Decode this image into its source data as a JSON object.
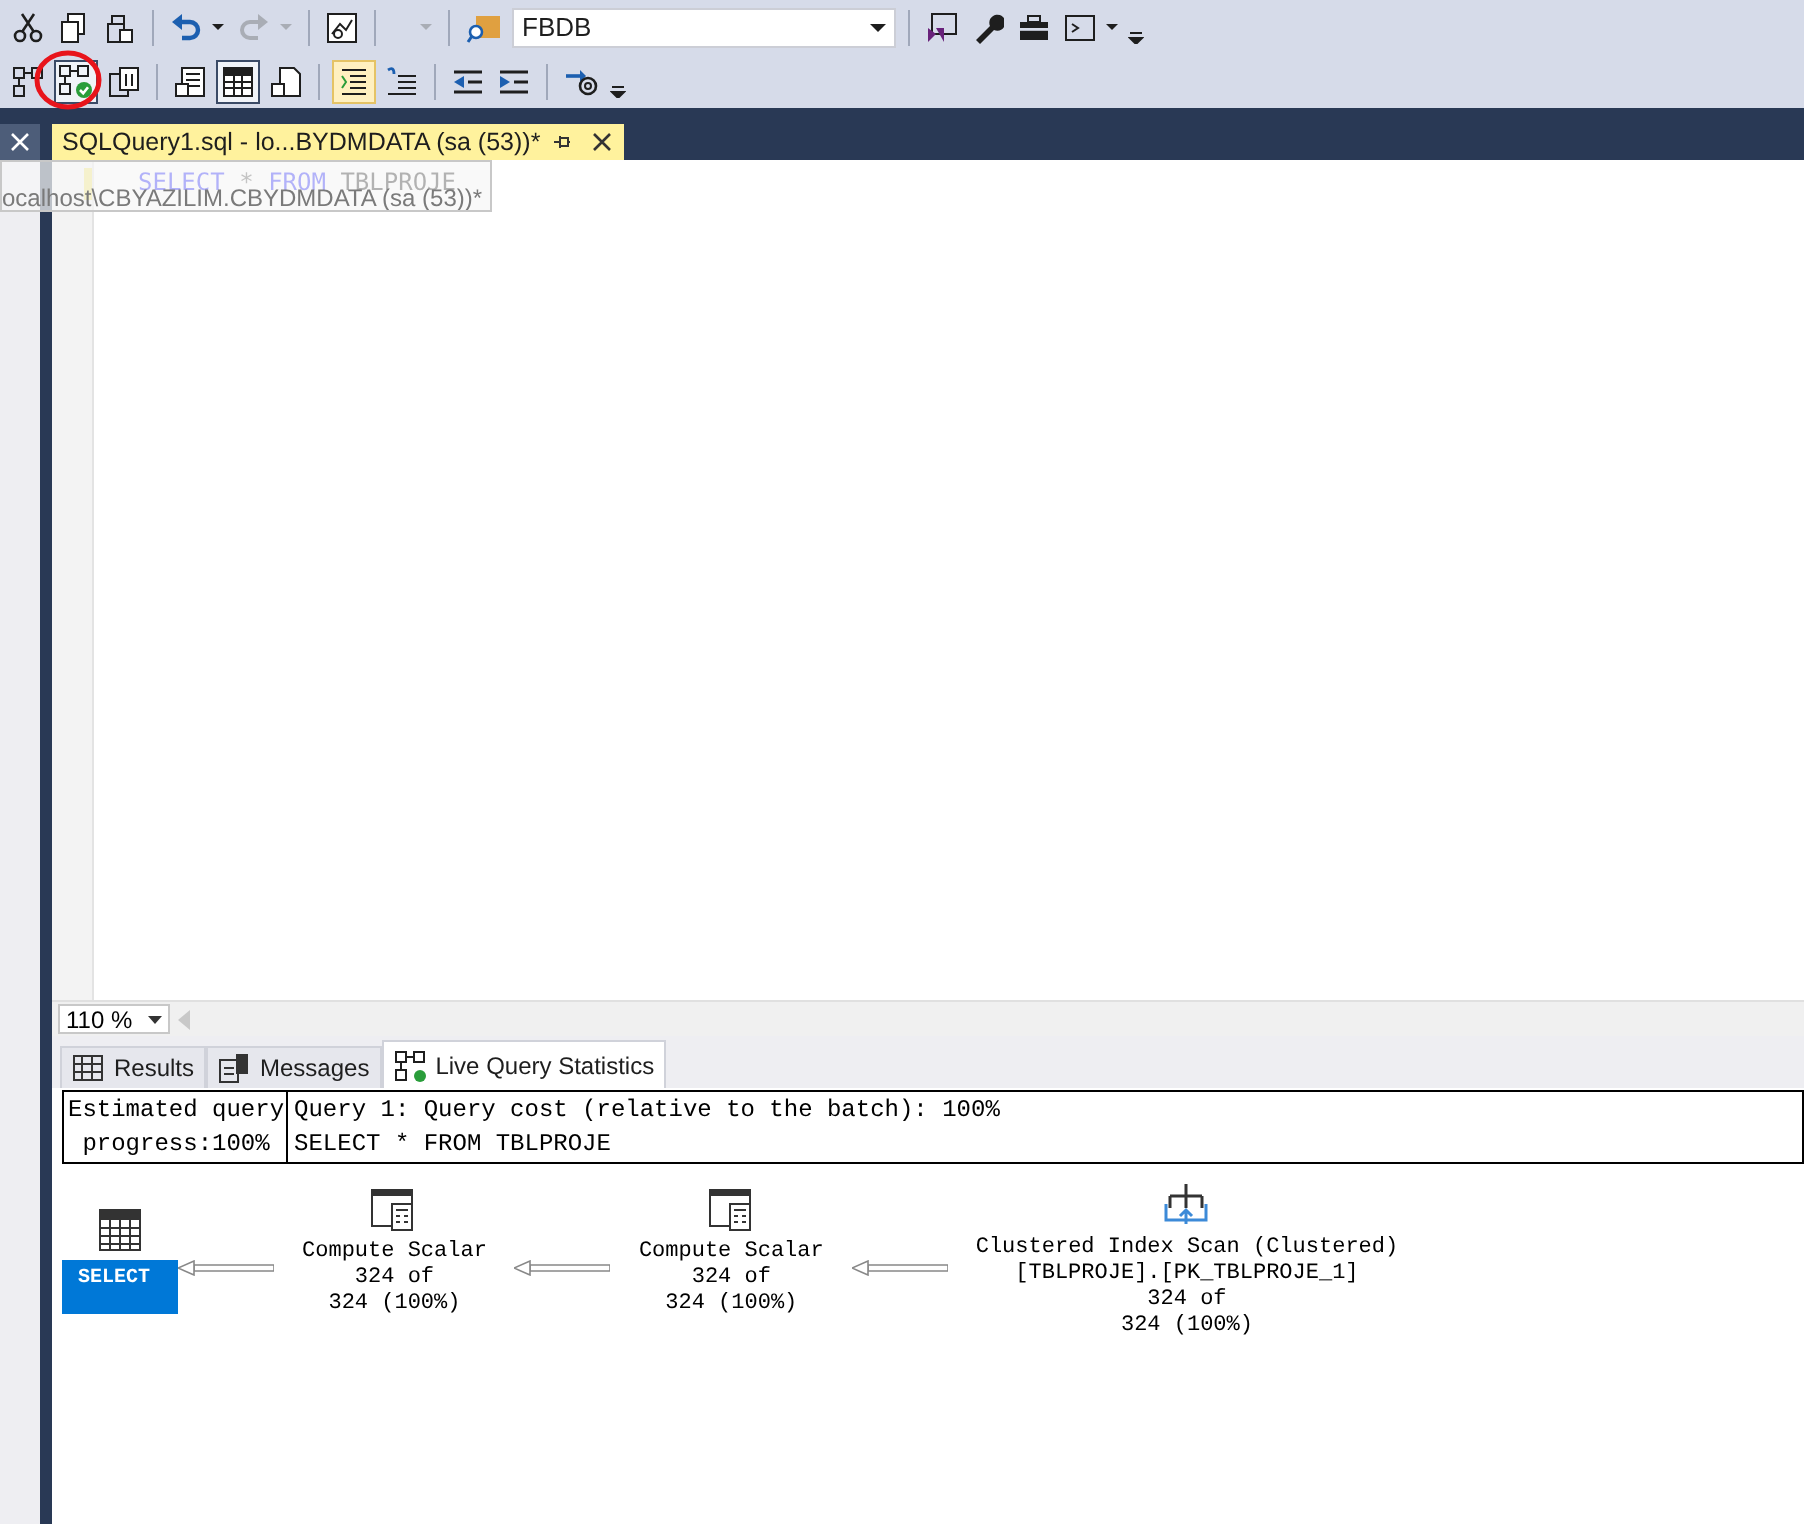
{
  "toolbar": {
    "database": "FBDB"
  },
  "document_tab": {
    "title": "SQLQuery1.sql - lo...BYDMDATA (sa (53))*",
    "tooltip": "ocalhost\\CBYAZILIM.CBYDMDATA (sa (53))*"
  },
  "editor": {
    "tokens": [
      {
        "kind": "keyword",
        "text": "SELECT"
      },
      {
        "kind": "operator",
        "text": "*"
      },
      {
        "kind": "keyword",
        "text": "FROM"
      },
      {
        "kind": "identifier",
        "text": "TBLPROJE"
      }
    ]
  },
  "zoom": "110 %",
  "result_tabs": [
    {
      "kind": "grid",
      "label": "Results",
      "selected": false
    },
    {
      "kind": "messages",
      "label": "Messages",
      "selected": false
    },
    {
      "kind": "live",
      "label": "Live Query Statistics",
      "selected": true
    }
  ],
  "plan": {
    "progress": [
      "Estimated query",
      "progress:100%"
    ],
    "query_header": "Query 1: Query cost (relative to the batch): 100%",
    "query_text": "SELECT * FROM TBLPROJE",
    "operators": [
      {
        "kind": "select",
        "name": "SELECT"
      },
      {
        "kind": "compute",
        "name": "Compute Scalar",
        "lines": [
          "324 of",
          "324 (100%)"
        ]
      },
      {
        "kind": "compute",
        "name": "Compute Scalar",
        "lines": [
          "324 of",
          "324 (100%)"
        ]
      },
      {
        "kind": "scan",
        "name": "Clustered Index Scan (Clustered)",
        "lines": [
          "[TBLPROJE].[PK_TBLPROJE_1]",
          "324 of",
          "324 (100%)"
        ]
      }
    ]
  }
}
